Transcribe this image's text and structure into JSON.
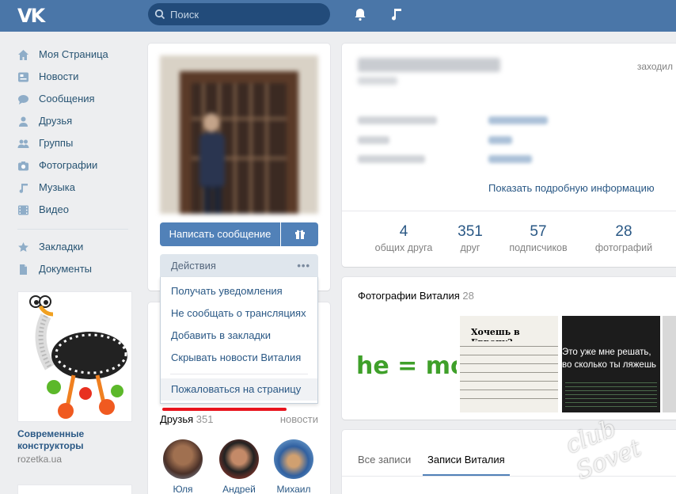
{
  "header": {
    "logo": "VK",
    "search_placeholder": "Поиск",
    "brand_color": "#4a76a8"
  },
  "nav": {
    "items": [
      {
        "label": "Моя Страница",
        "icon": "home-icon"
      },
      {
        "label": "Новости",
        "icon": "news-icon"
      },
      {
        "label": "Сообщения",
        "icon": "messages-icon"
      },
      {
        "label": "Друзья",
        "icon": "user-icon"
      },
      {
        "label": "Группы",
        "icon": "group-icon"
      },
      {
        "label": "Фотографии",
        "icon": "camera-icon"
      },
      {
        "label": "Музыка",
        "icon": "music-icon"
      },
      {
        "label": "Видео",
        "icon": "video-icon"
      }
    ],
    "items2": [
      {
        "label": "Закладки",
        "icon": "star-icon"
      },
      {
        "label": "Документы",
        "icon": "document-icon"
      }
    ]
  },
  "ad": {
    "title": "Современные конструкторы",
    "domain": "rozetka.ua"
  },
  "profile": {
    "write_message": "Написать сообщение",
    "actions": "Действия",
    "actions_dots": "•••",
    "menu": [
      "Получать уведомления",
      "Не сообщать о трансляциях",
      "Добавить в закладки",
      "Скрывать новости Виталия"
    ],
    "report": "Пожаловаться на страницу",
    "highlight_color": "#e8141d"
  },
  "friends": {
    "title": "Друзья",
    "count": "351",
    "news_link": "новости",
    "people": [
      "Юля",
      "Андрей",
      "Михаил"
    ]
  },
  "info": {
    "status": "заходил",
    "show_more": "Показать подробную информацию",
    "stats": [
      {
        "value": "4",
        "label": "общих друга"
      },
      {
        "value": "351",
        "label": "друг"
      },
      {
        "value": "57",
        "label": "подписчиков"
      },
      {
        "value": "28",
        "label": "фотографий"
      }
    ]
  },
  "photos": {
    "title": "Фотографии Виталия",
    "count": "28",
    "tile1_text": "he = mo",
    "tile2_title": "Хочешь в Европу?",
    "tile3_text": "Это уже мне решать, во сколько ты ляжешь спать"
  },
  "wall": {
    "tabs": [
      "Все записи",
      "Записи Виталия"
    ]
  },
  "watermark": "club Sovet"
}
